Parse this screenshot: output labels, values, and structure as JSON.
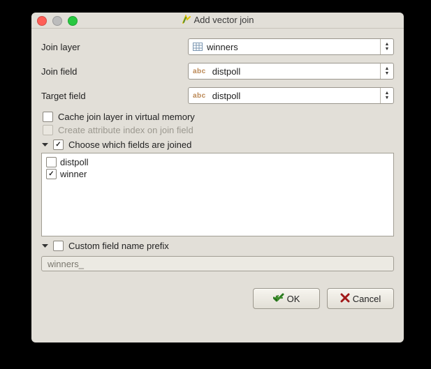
{
  "window": {
    "title": "Add vector join"
  },
  "form": {
    "joinLayer": {
      "label": "Join layer",
      "value": "winners"
    },
    "joinField": {
      "label": "Join field",
      "value": "distpoll",
      "typeIcon": "abc"
    },
    "targetField": {
      "label": "Target field",
      "value": "distpoll",
      "typeIcon": "abc"
    },
    "cacheJoin": {
      "label": "Cache join layer in virtual memory",
      "checked": false
    },
    "createIndex": {
      "label": "Create attribute index on join field",
      "checked": false,
      "disabled": true
    },
    "chooseFields": {
      "label": "Choose which fields are joined",
      "checked": true,
      "fields": [
        {
          "name": "distpoll",
          "checked": false
        },
        {
          "name": "winner",
          "checked": true
        }
      ]
    },
    "customPrefix": {
      "label": "Custom field name prefix",
      "checked": false,
      "value": "winners_"
    }
  },
  "buttons": {
    "ok": "OK",
    "cancel": "Cancel"
  }
}
